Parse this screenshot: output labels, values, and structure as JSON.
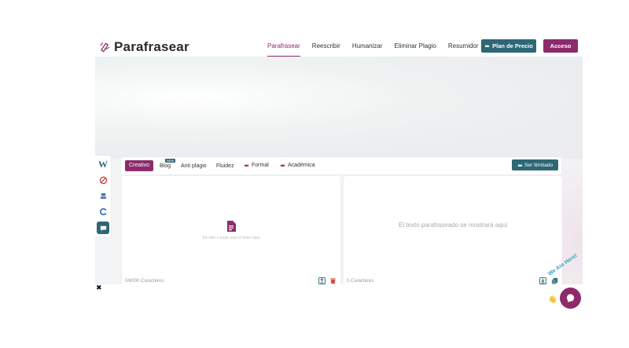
{
  "header": {
    "brand": "Parafrasear",
    "nav": [
      "Parafrasear",
      "Reescribir",
      "Humanizar",
      "Eliminar Plagio",
      "Resumidor"
    ],
    "active_nav": "Parafrasear",
    "plan_button": "Plan de Precio",
    "login_button": "Acceso"
  },
  "side_rail": {
    "icons": [
      "wordpress-icon",
      "no-ads-icon",
      "robot-icon",
      "chrome-icon",
      "chat-icon"
    ]
  },
  "toolbar": {
    "modes": [
      {
        "label": "Creativo",
        "active": true
      },
      {
        "label": "Blog",
        "badge": "NEW"
      },
      {
        "label": "Anti plagio"
      },
      {
        "label": "Fluidez"
      },
      {
        "label": "Formal",
        "premium": true
      },
      {
        "label": "Académica",
        "premium": true
      }
    ],
    "premium_button": "Ser Ilimitado"
  },
  "input_panel": {
    "placeholder": "Escribe o pega aquí el texto aquí",
    "char_count": "0/6000 Caracteres"
  },
  "output_panel": {
    "placeholder": "El texto parafraseado se mostrará aquí",
    "char_count": "0 Caracteres"
  },
  "chat_widget": {
    "label": "We Are Here!"
  },
  "colors": {
    "accent": "#8d2b6a",
    "teal": "#2e6775"
  }
}
